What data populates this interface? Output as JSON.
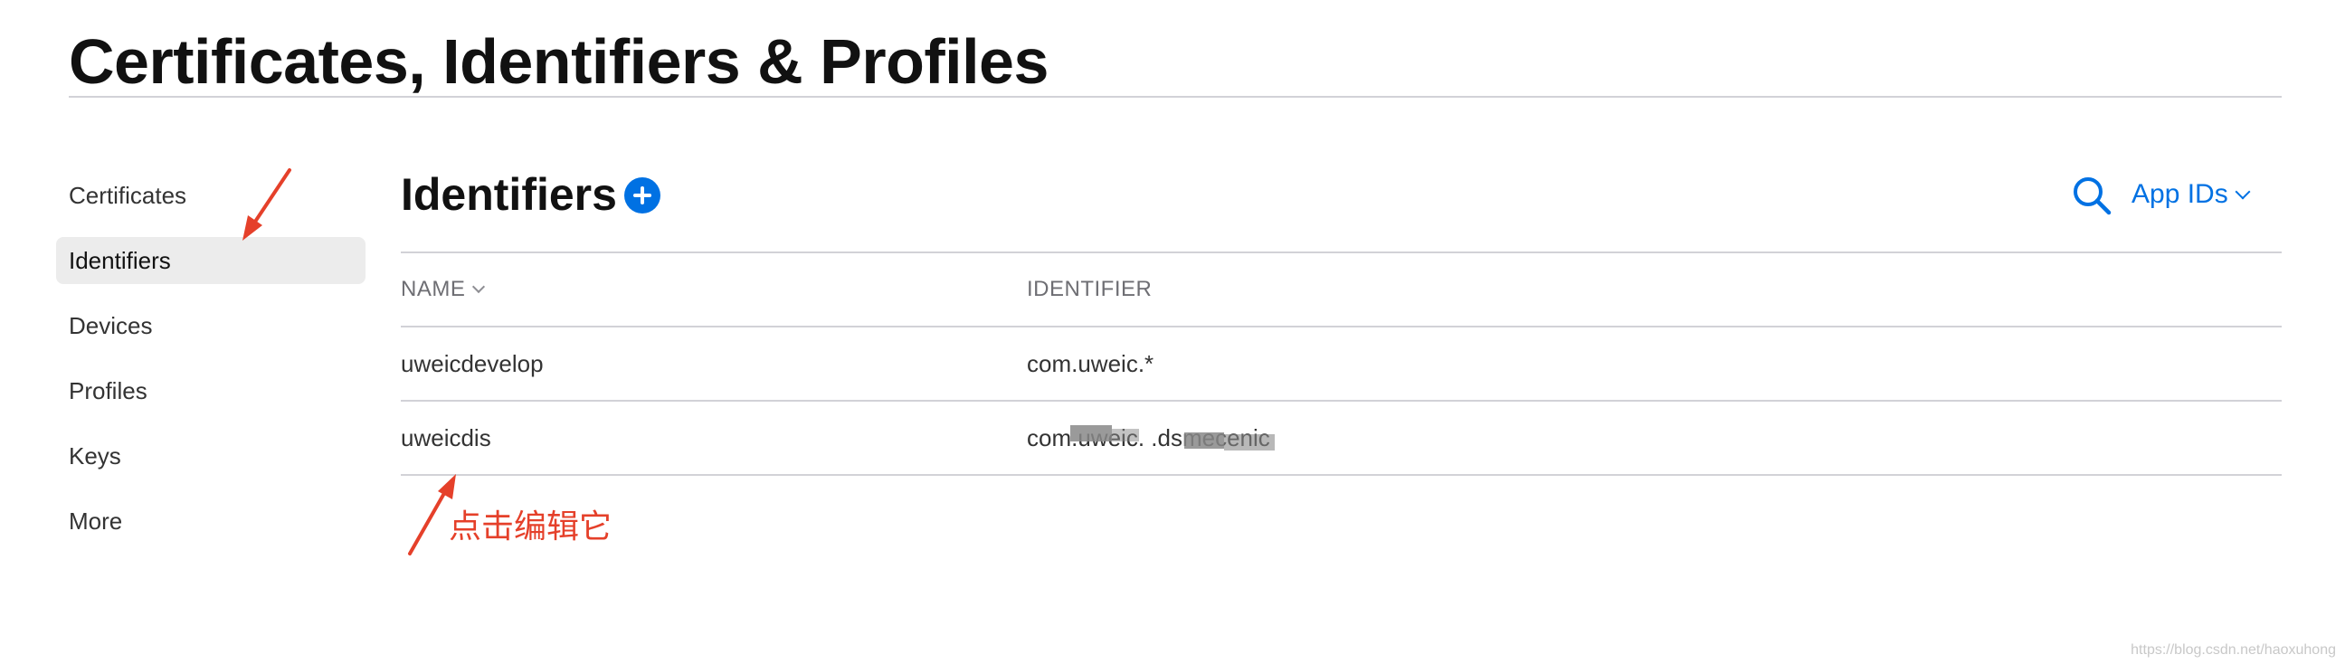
{
  "page_title": "Certificates, Identifiers & Profiles",
  "sidebar": {
    "items": [
      {
        "label": "Certificates",
        "active": false
      },
      {
        "label": "Identifiers",
        "active": true
      },
      {
        "label": "Devices",
        "active": false
      },
      {
        "label": "Profiles",
        "active": false
      },
      {
        "label": "Keys",
        "active": false
      },
      {
        "label": "More",
        "active": false
      }
    ]
  },
  "main": {
    "section_title": "Identifiers",
    "filter_label": "App IDs",
    "table": {
      "columns": [
        "NAME",
        "IDENTIFIER"
      ],
      "rows": [
        {
          "name": "uweicdevelop",
          "identifier": "com.uweic.*"
        },
        {
          "name": "uweicdis",
          "identifier": "com.uweic.   .dsmecenic"
        }
      ]
    }
  },
  "annotation": {
    "text": "点击编辑它"
  },
  "watermark": "https://blog.csdn.net/haoxuhong",
  "colors": {
    "accent": "#0071e3",
    "annotation": "#e5402a",
    "active_bg": "#ececec",
    "divider": "#d2d2d7"
  },
  "icons": [
    "plus-circle-icon",
    "search-icon",
    "chevron-down-icon",
    "red-arrow"
  ]
}
